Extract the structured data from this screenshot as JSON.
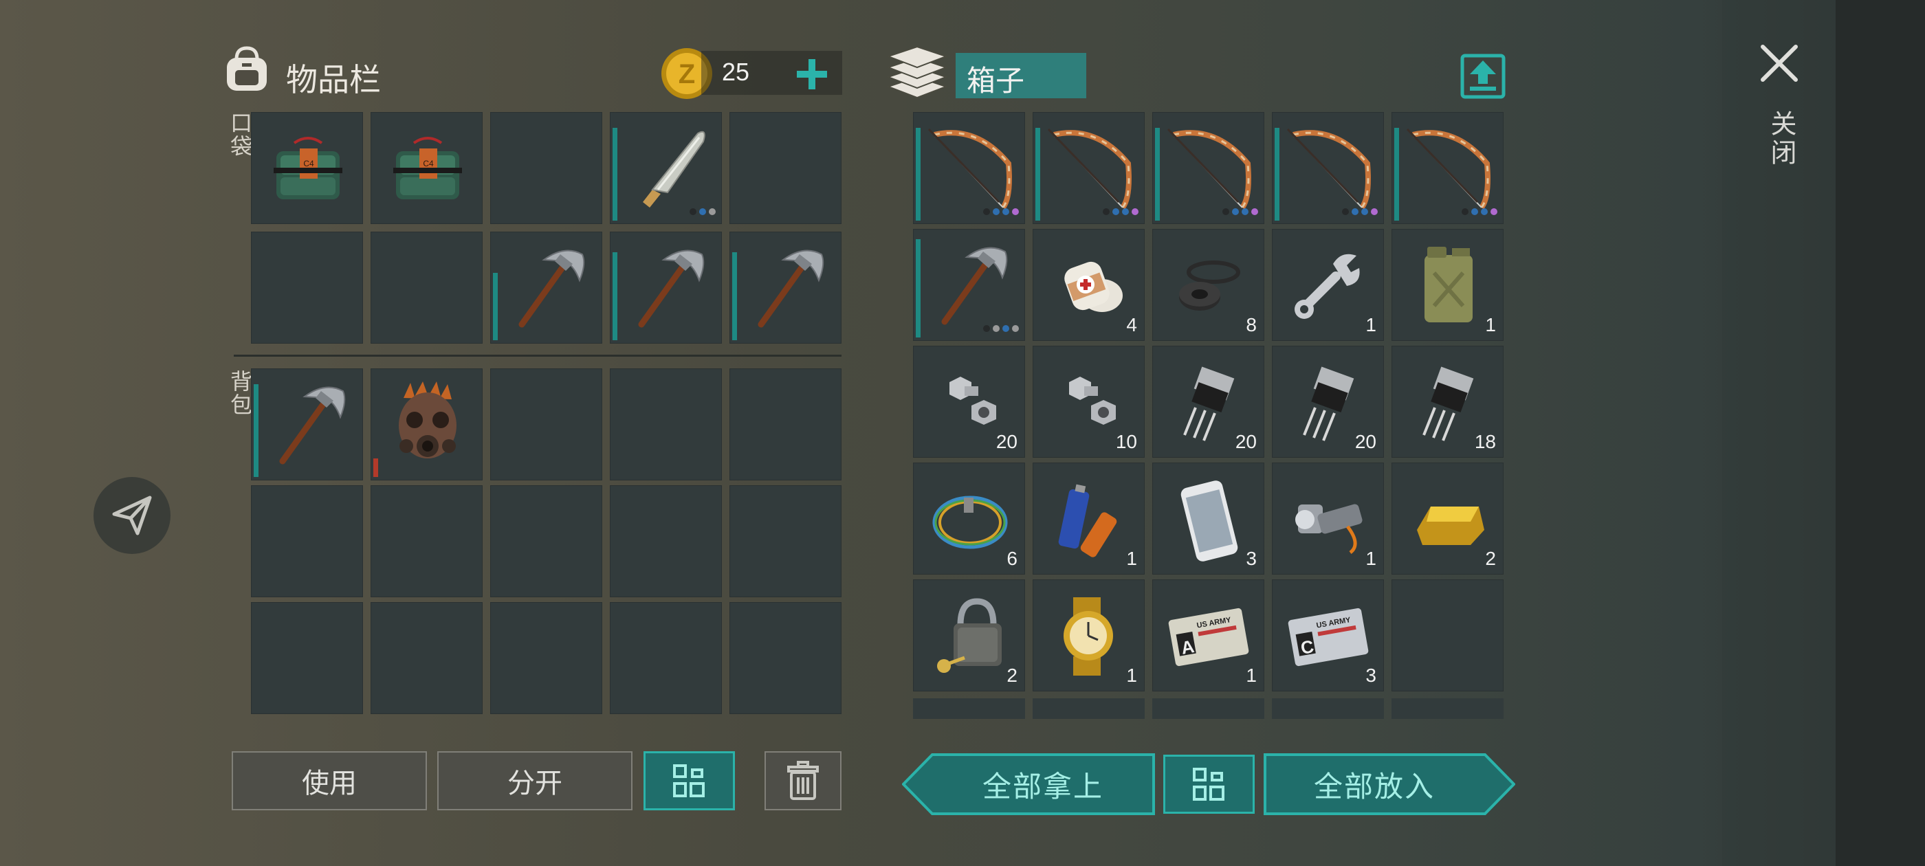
{
  "inventory": {
    "title": "物品栏",
    "coins": "25",
    "pockets_label": "口袋",
    "backpack_label": "背包",
    "pockets": [
      {
        "icon": "c4-explosive-icon",
        "count": "",
        "durability": 0
      },
      {
        "icon": "c4-explosive-icon",
        "count": "",
        "durability": 0
      },
      {
        "icon": "",
        "count": "",
        "durability": 0
      },
      {
        "icon": "machete-icon",
        "count": "",
        "durability": 0.9,
        "dots": [
          "#26292a",
          "#2f6fb0",
          "#9a9a9a"
        ]
      },
      {
        "icon": "",
        "count": "",
        "durability": 0
      },
      {
        "icon": "",
        "count": "",
        "durability": 0
      },
      {
        "icon": "",
        "count": "",
        "durability": 0
      },
      {
        "icon": "pickaxe-icon",
        "count": "",
        "durability": 0.65
      },
      {
        "icon": "pickaxe-icon",
        "count": "",
        "durability": 0.85
      },
      {
        "icon": "pickaxe-icon",
        "count": "",
        "durability": 0.85
      }
    ],
    "backpack": [
      {
        "icon": "pickaxe-icon",
        "count": "",
        "durability": 0.9
      },
      {
        "icon": "gas-mask-icon",
        "count": "",
        "durability": 0.18,
        "red": true
      },
      {
        "icon": "",
        "count": ""
      },
      {
        "icon": "",
        "count": ""
      },
      {
        "icon": "",
        "count": ""
      },
      {
        "icon": "",
        "count": ""
      },
      {
        "icon": "",
        "count": ""
      },
      {
        "icon": "",
        "count": ""
      },
      {
        "icon": "",
        "count": ""
      },
      {
        "icon": "",
        "count": ""
      },
      {
        "icon": "",
        "count": ""
      },
      {
        "icon": "",
        "count": ""
      },
      {
        "icon": "",
        "count": ""
      },
      {
        "icon": "",
        "count": ""
      },
      {
        "icon": "",
        "count": ""
      }
    ],
    "buttons": {
      "use": "使用",
      "split": "分开"
    }
  },
  "box": {
    "title": "箱子",
    "items": [
      {
        "icon": "bow-icon",
        "count": "",
        "durability": 0.9,
        "dots": [
          "#26292a",
          "#2f6fb0",
          "#2f6fb0",
          "#b06ad0"
        ]
      },
      {
        "icon": "bow-icon",
        "count": "",
        "durability": 0.9,
        "dots": [
          "#26292a",
          "#2f6fb0",
          "#2f6fb0",
          "#b06ad0"
        ]
      },
      {
        "icon": "bow-icon",
        "count": "",
        "durability": 0.9,
        "dots": [
          "#26292a",
          "#2f6fb0",
          "#2f6fb0",
          "#b06ad0"
        ]
      },
      {
        "icon": "bow-icon",
        "count": "",
        "durability": 0.9,
        "dots": [
          "#26292a",
          "#2f6fb0",
          "#2f6fb0",
          "#b06ad0"
        ]
      },
      {
        "icon": "bow-icon",
        "count": "",
        "durability": 0.9,
        "dots": [
          "#26292a",
          "#2f6fb0",
          "#2f6fb0",
          "#b06ad0"
        ]
      },
      {
        "icon": "pickaxe-icon",
        "count": "",
        "durability": 0.95,
        "dots": [
          "#26292a",
          "#9a9a9a",
          "#2f6fb0",
          "#9a9a9a"
        ]
      },
      {
        "icon": "bandage-icon",
        "count": "4"
      },
      {
        "icon": "rubber-parts-icon",
        "count": "8"
      },
      {
        "icon": "wrench-icon",
        "count": "1"
      },
      {
        "icon": "jerry-can-icon",
        "count": "1"
      },
      {
        "icon": "bolts-icon",
        "count": "20"
      },
      {
        "icon": "bolts-icon",
        "count": "10"
      },
      {
        "icon": "transistor-icon",
        "count": "20"
      },
      {
        "icon": "transistor-icon",
        "count": "20"
      },
      {
        "icon": "transistor-icon",
        "count": "18"
      },
      {
        "icon": "wires-icon",
        "count": "6"
      },
      {
        "icon": "batteries-icon",
        "count": "1"
      },
      {
        "icon": "smartphone-icon",
        "count": "3"
      },
      {
        "icon": "flashlight-icon",
        "count": "1"
      },
      {
        "icon": "gold-bar-icon",
        "count": "2"
      },
      {
        "icon": "padlock-icon",
        "count": "2"
      },
      {
        "icon": "gold-watch-icon",
        "count": "1"
      },
      {
        "icon": "army-card-a-icon",
        "count": "1",
        "card_letter": "A",
        "card_text": "US ARMY"
      },
      {
        "icon": "army-card-c-icon",
        "count": "3",
        "card_letter": "C",
        "card_text": "US ARMY"
      },
      {
        "icon": "",
        "count": ""
      }
    ],
    "buttons": {
      "take_all": "全部拿上",
      "put_all": "全部放入"
    }
  },
  "close_label": "关闭",
  "colors": {
    "accent": "#2bb3aa",
    "slot": "#323b3c",
    "durability": "#1e8a83"
  }
}
